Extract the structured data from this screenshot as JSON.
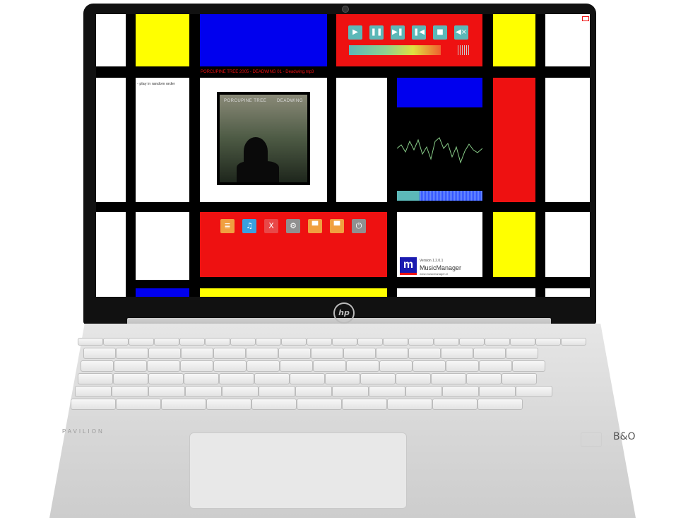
{
  "track_title": "PORCUPINE TREE 2005 - DEADWING 01 - Deadwing.mp3",
  "random_label": "- play in random order",
  "album_art": {
    "band": "PORCUPINE TREE",
    "album": "DEADWING"
  },
  "player_controls": [
    {
      "name": "play",
      "glyph": "▶"
    },
    {
      "name": "pause",
      "glyph": "❚❚"
    },
    {
      "name": "next",
      "glyph": "▶❚"
    },
    {
      "name": "previous",
      "glyph": "❚◀"
    },
    {
      "name": "stop",
      "glyph": "■"
    },
    {
      "name": "mute",
      "glyph": "◀×"
    }
  ],
  "toolbar": [
    {
      "name": "playlist",
      "glyph": "≣",
      "color": "#f0a040"
    },
    {
      "name": "music",
      "glyph": "♫",
      "color": "#3aa0e0"
    },
    {
      "name": "close",
      "glyph": "X",
      "color": "#e84848"
    },
    {
      "name": "settings",
      "glyph": "⚙",
      "color": "#909090"
    },
    {
      "name": "folder-open",
      "glyph": "▀",
      "color": "#f0a040"
    },
    {
      "name": "folder-add",
      "glyph": "▀",
      "color": "#f0a040"
    },
    {
      "name": "power",
      "glyph": "⏻",
      "color": "#909090"
    }
  ],
  "logo": {
    "version": "Version 1.2.0.1",
    "name": "MusicManager",
    "url": "www.musicmanager.nl"
  },
  "volume_level": 0.82,
  "laptop": {
    "brand": "hp",
    "model": "PAVILION",
    "audio": "B&O"
  },
  "colors": {
    "red": "#ee1111",
    "yellow": "#ffff00",
    "blue": "#0000ee",
    "white": "#ffffff",
    "accent": "#5cb8b8"
  }
}
